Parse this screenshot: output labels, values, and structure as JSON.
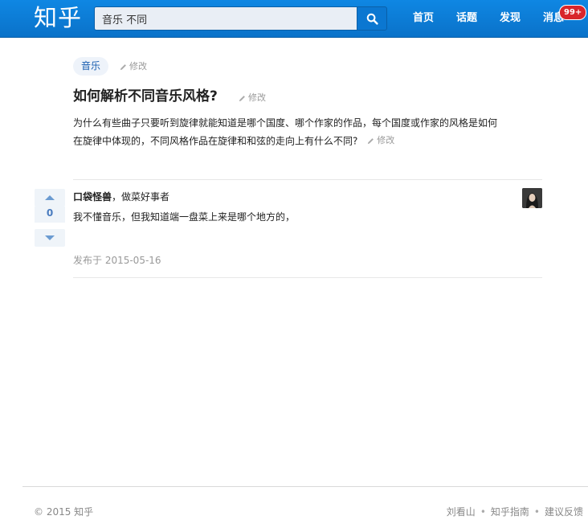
{
  "header": {
    "logo": "知乎",
    "search_value": "音乐 不同",
    "nav": [
      "首页",
      "话题",
      "发现",
      "消息"
    ],
    "badge": "99+",
    "colors": {
      "bar": "#0f87e3",
      "badge": "#d8262b"
    }
  },
  "question": {
    "topic": "音乐",
    "edit_label": "修改",
    "title": "如何解析不同音乐风格?",
    "detail_line1": "为什么有些曲子只要听到旋律就能知道是哪个国度、哪个作家的作品，每个国度或作家的风格是如何",
    "detail_line2": "在旋律中体现的，不同风格作品在旋律和和弦的走向上有什么不同?"
  },
  "answer": {
    "votes": "0",
    "author_name": "口袋怪兽",
    "author_bio": "，做菜好事者",
    "content": "我不懂音乐，但我知道端一盘菜上来是哪个地方的，",
    "date": "发布于 2015-05-16"
  },
  "footer": {
    "copyright": "© 2015 知乎",
    "links": [
      "刘看山",
      "知乎指南",
      "建议反馈"
    ],
    "separator": "•"
  }
}
